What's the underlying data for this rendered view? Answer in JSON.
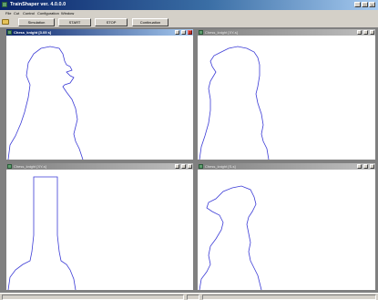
{
  "app": {
    "title": "TrainShaper  ver. 4.0.0.0",
    "window_controls": {
      "minimize": "_",
      "maximize": "□",
      "close": "×"
    }
  },
  "menu": [
    "File",
    "Cut",
    "Control",
    "Configuration",
    "Window"
  ],
  "toolbar": {
    "folder_icon": "open-folder-icon",
    "simulation_label": "Simulation",
    "start_label": "START",
    "stop_label": "STOP",
    "continuation_label": "Continuation"
  },
  "windows": [
    {
      "title": "Chess_knight [3.05 s]",
      "active": true,
      "shape": "knight"
    },
    {
      "title": "Chess_knight [XY-s]",
      "active": false,
      "shape": "knight"
    },
    {
      "title": "Chess_knight [XY-s]",
      "active": false,
      "shape": "post"
    },
    {
      "title": "Chess_knight [S-s]",
      "active": false,
      "shape": "knight-side"
    }
  ],
  "colors": {
    "active_title": "#0a246a",
    "inactive_title": "#808080",
    "path_stroke": "#3b3bd6",
    "workspace": "#808080"
  }
}
